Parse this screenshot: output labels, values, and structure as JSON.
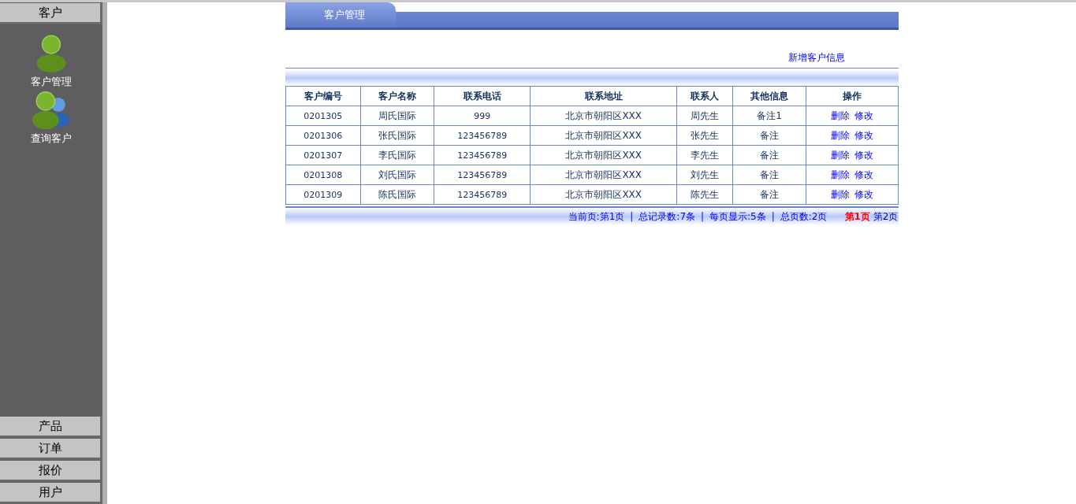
{
  "sidebar": {
    "sections": [
      {
        "label": "客户",
        "items": [
          {
            "label": "客户管理"
          },
          {
            "label": "查询客户"
          }
        ]
      },
      {
        "label": "产品"
      },
      {
        "label": "订单"
      },
      {
        "label": "报价"
      },
      {
        "label": "用户"
      }
    ]
  },
  "tab": {
    "title": "客户管理"
  },
  "add_link": "新增客户信息",
  "table": {
    "columns": [
      "客户编号",
      "客户名称",
      "联系电话",
      "联系地址",
      "联系人",
      "其他信息",
      "操作"
    ],
    "rows": [
      {
        "cells": [
          "0201305",
          "周氏国际",
          "999",
          "北京市朝阳区XXX",
          "周先生",
          "备注1"
        ],
        "actions": [
          "删除",
          "修改"
        ]
      },
      {
        "cells": [
          "0201306",
          "张氏国际",
          "123456789",
          "北京市朝阳区XXX",
          "张先生",
          "备注"
        ],
        "actions": [
          "删除",
          "修改"
        ]
      },
      {
        "cells": [
          "0201307",
          "李氏国际",
          "123456789",
          "北京市朝阳区XXX",
          "李先生",
          "备注"
        ],
        "actions": [
          "删除",
          "修改"
        ]
      },
      {
        "cells": [
          "0201308",
          "刘氏国际",
          "123456789",
          "北京市朝阳区XXX",
          "刘先生",
          "备注"
        ],
        "actions": [
          "删除",
          "修改"
        ]
      },
      {
        "cells": [
          "0201309",
          "陈氏国际",
          "123456789",
          "北京市朝阳区XXX",
          "陈先生",
          "备注"
        ],
        "actions": [
          "删除",
          "修改"
        ]
      }
    ]
  },
  "pagination": {
    "info": [
      "当前页:第1页",
      "总记录数:7条",
      "每页显示:5条",
      "总页数:2页"
    ],
    "separator": "|",
    "pages": [
      {
        "label": "第1页",
        "selected": true
      },
      {
        "label": "第2页",
        "selected": false
      }
    ]
  }
}
